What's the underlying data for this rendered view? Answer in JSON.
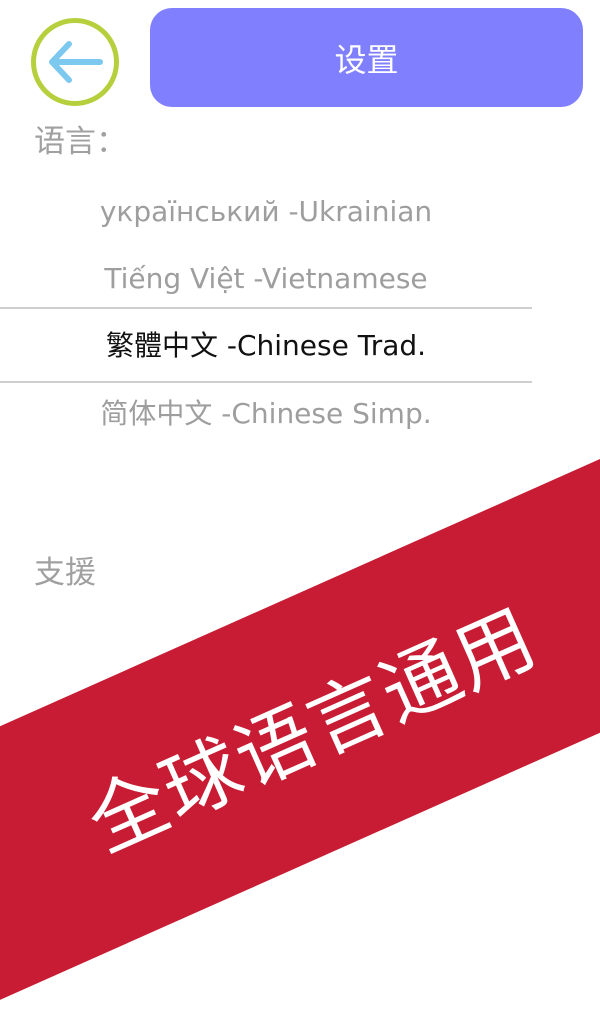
{
  "header": {
    "back_icon": "arrow-left-icon",
    "title": "设置",
    "colors": {
      "title_bar": "#8080ff",
      "back_ring": "#b6cf3c",
      "back_arrow": "#7cc8ee"
    }
  },
  "language_section": {
    "label": "语言：",
    "options": [
      {
        "label": "український -Ukrainian"
      },
      {
        "label": "Tiếng Việt -Vietnamese"
      },
      {
        "label": "繁體中文 -Chinese Trad."
      },
      {
        "label": "简体中文 -Chinese Simp."
      }
    ],
    "selected": "繁體中文 -Chinese Trad."
  },
  "support_section": {
    "label": "支援"
  },
  "banner": {
    "text": "全球语言通用",
    "color": "#c71c33"
  }
}
